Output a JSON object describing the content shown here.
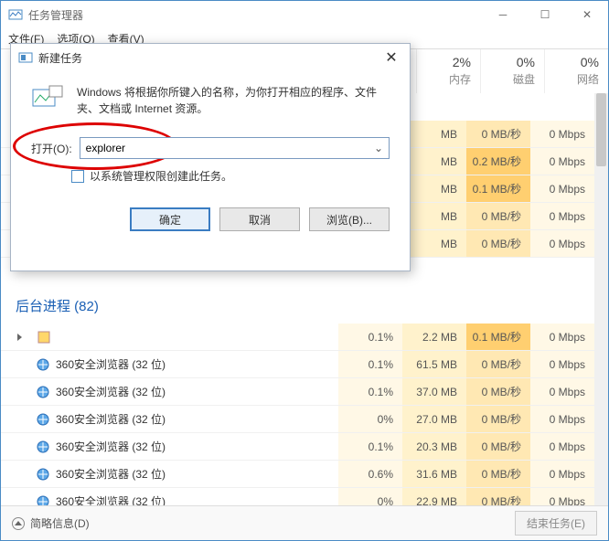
{
  "window": {
    "title": "任务管理器",
    "menu": {
      "file": "文件(F)",
      "options": "选项(O)",
      "view": "查看(V)"
    }
  },
  "columns": {
    "cpu": {
      "pct": "2%",
      "label": "内存"
    },
    "disk": {
      "pct": "0%",
      "label": "磁盘"
    },
    "net": {
      "pct": "0%",
      "label": "网络"
    }
  },
  "section": {
    "bg_title": "后台进程 (82)"
  },
  "rows": [
    {
      "name": "",
      "cpu": "MB",
      "disk": "0 MB/秒",
      "net": "0 Mbps",
      "hot": false
    },
    {
      "name": "",
      "cpu": "MB",
      "disk": "0.2 MB/秒",
      "net": "0 Mbps",
      "hot": true
    },
    {
      "name": "",
      "cpu": "MB",
      "disk": "0.1 MB/秒",
      "net": "0 Mbps",
      "hot": true
    },
    {
      "name": "",
      "cpu": "MB",
      "disk": "0 MB/秒",
      "net": "0 Mbps",
      "hot": false
    },
    {
      "name": "",
      "cpu": "MB",
      "disk": "0 MB/秒",
      "net": "0 Mbps",
      "hot": false
    }
  ],
  "bg_rows": [
    {
      "name": "",
      "cpu": "0.1%",
      "mem": "2.2 MB",
      "disk": "0.1 MB/秒",
      "net": "0 Mbps",
      "hot": true
    },
    {
      "name": "360安全浏览器 (32 位)",
      "cpu": "0.1%",
      "mem": "61.5 MB",
      "disk": "0 MB/秒",
      "net": "0 Mbps",
      "hot": false
    },
    {
      "name": "360安全浏览器 (32 位)",
      "cpu": "0.1%",
      "mem": "37.0 MB",
      "disk": "0 MB/秒",
      "net": "0 Mbps",
      "hot": false
    },
    {
      "name": "360安全浏览器 (32 位)",
      "cpu": "0%",
      "mem": "27.0 MB",
      "disk": "0 MB/秒",
      "net": "0 Mbps",
      "hot": false
    },
    {
      "name": "360安全浏览器 (32 位)",
      "cpu": "0.1%",
      "mem": "20.3 MB",
      "disk": "0 MB/秒",
      "net": "0 Mbps",
      "hot": false
    },
    {
      "name": "360安全浏览器 (32 位)",
      "cpu": "0.6%",
      "mem": "31.6 MB",
      "disk": "0 MB/秒",
      "net": "0 Mbps",
      "hot": false
    },
    {
      "name": "360安全浏览器 (32 位)",
      "cpu": "0%",
      "mem": "22.9 MB",
      "disk": "0 MB/秒",
      "net": "0 Mbps",
      "hot": false
    }
  ],
  "footer": {
    "less": "简略信息(D)",
    "end": "结束任务(E)"
  },
  "dialog": {
    "title": "新建任务",
    "message": "Windows 将根据你所键入的名称，为你打开相应的程序、文件夹、文档或 Internet 资源。",
    "open_label": "打开(O):",
    "value": "explorer",
    "admin_check": "以系统管理权限创建此任务。",
    "ok": "确定",
    "cancel": "取消",
    "browse": "浏览(B)..."
  }
}
